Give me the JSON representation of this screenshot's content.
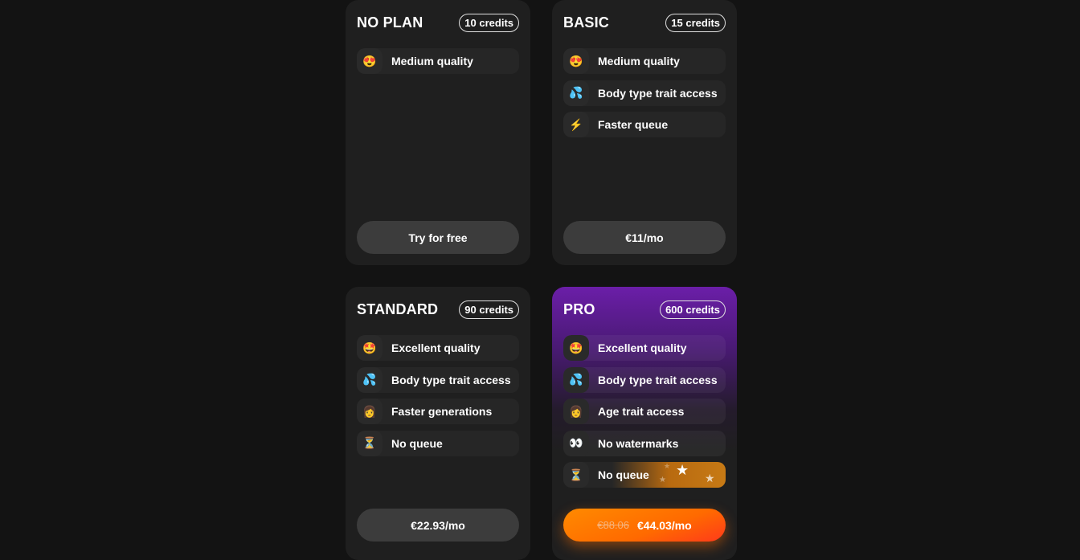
{
  "plans": [
    {
      "name": "NO PLAN",
      "credits": "10 credits",
      "features": [
        {
          "icon": "heart-eyes-icon",
          "glyph": "😍",
          "label": "Medium quality"
        }
      ],
      "button": "Try for free"
    },
    {
      "name": "BASIC",
      "credits": "15 credits",
      "features": [
        {
          "icon": "heart-eyes-icon",
          "glyph": "😍",
          "label": "Medium quality"
        },
        {
          "icon": "sweat-droplets-icon",
          "glyph": "💦",
          "label": "Body type trait access"
        },
        {
          "icon": "lightning-icon",
          "glyph": "⚡",
          "label": "Faster queue"
        }
      ],
      "button": "€11/mo"
    },
    {
      "name": "STANDARD",
      "credits": "90 credits",
      "features": [
        {
          "icon": "star-struck-icon",
          "glyph": "🤩",
          "label": "Excellent quality"
        },
        {
          "icon": "sweat-droplets-icon",
          "glyph": "💦",
          "label": "Body type trait access"
        },
        {
          "icon": "woman-icon",
          "glyph": "👩",
          "label": "Faster generations"
        },
        {
          "icon": "hourglass-icon",
          "glyph": "⏳",
          "label": "No queue"
        }
      ],
      "button": "€22.93/mo"
    },
    {
      "name": "PRO",
      "credits": "600 credits",
      "features": [
        {
          "icon": "star-struck-icon",
          "glyph": "🤩",
          "label": "Excellent quality"
        },
        {
          "icon": "sweat-droplets-icon",
          "glyph": "💦",
          "label": "Body type trait access"
        },
        {
          "icon": "woman-icon",
          "glyph": "👩",
          "label": "Age trait access"
        },
        {
          "icon": "eyes-icon",
          "glyph": "👀",
          "label": "No watermarks"
        },
        {
          "icon": "hourglass-icon",
          "glyph": "⏳",
          "label": "No queue"
        }
      ],
      "button_old_price": "€88.06",
      "button": "€44.03/mo"
    }
  ]
}
